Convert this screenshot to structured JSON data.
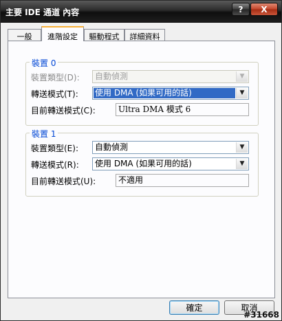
{
  "window": {
    "title": "主要 IDE 通道 內容",
    "help_label": "?",
    "close_label": "X"
  },
  "tabs": [
    {
      "label": "一般"
    },
    {
      "label": "進階設定"
    },
    {
      "label": "驅動程式"
    },
    {
      "label": "詳細資料"
    }
  ],
  "device0": {
    "title": "裝置 0",
    "type_label": "裝置類型(D):",
    "type_value": "自動偵測",
    "mode_label": "轉送模式(T):",
    "mode_value": "使用 DMA (如果可用的話)",
    "current_label": "目前轉送模式(C):",
    "current_value": "Ultra DMA 模式 6"
  },
  "device1": {
    "title": "裝置 1",
    "type_label": "裝置類型(E):",
    "type_value": "自動偵測",
    "mode_label": "轉送模式(R):",
    "mode_value": "使用 DMA (如果可用的話)",
    "current_label": "目前轉送模式(U):",
    "current_value": "不適用"
  },
  "buttons": {
    "ok": "確定",
    "cancel": "取消"
  },
  "watermark": "#31668",
  "icons": {
    "dropdown": "▼"
  }
}
